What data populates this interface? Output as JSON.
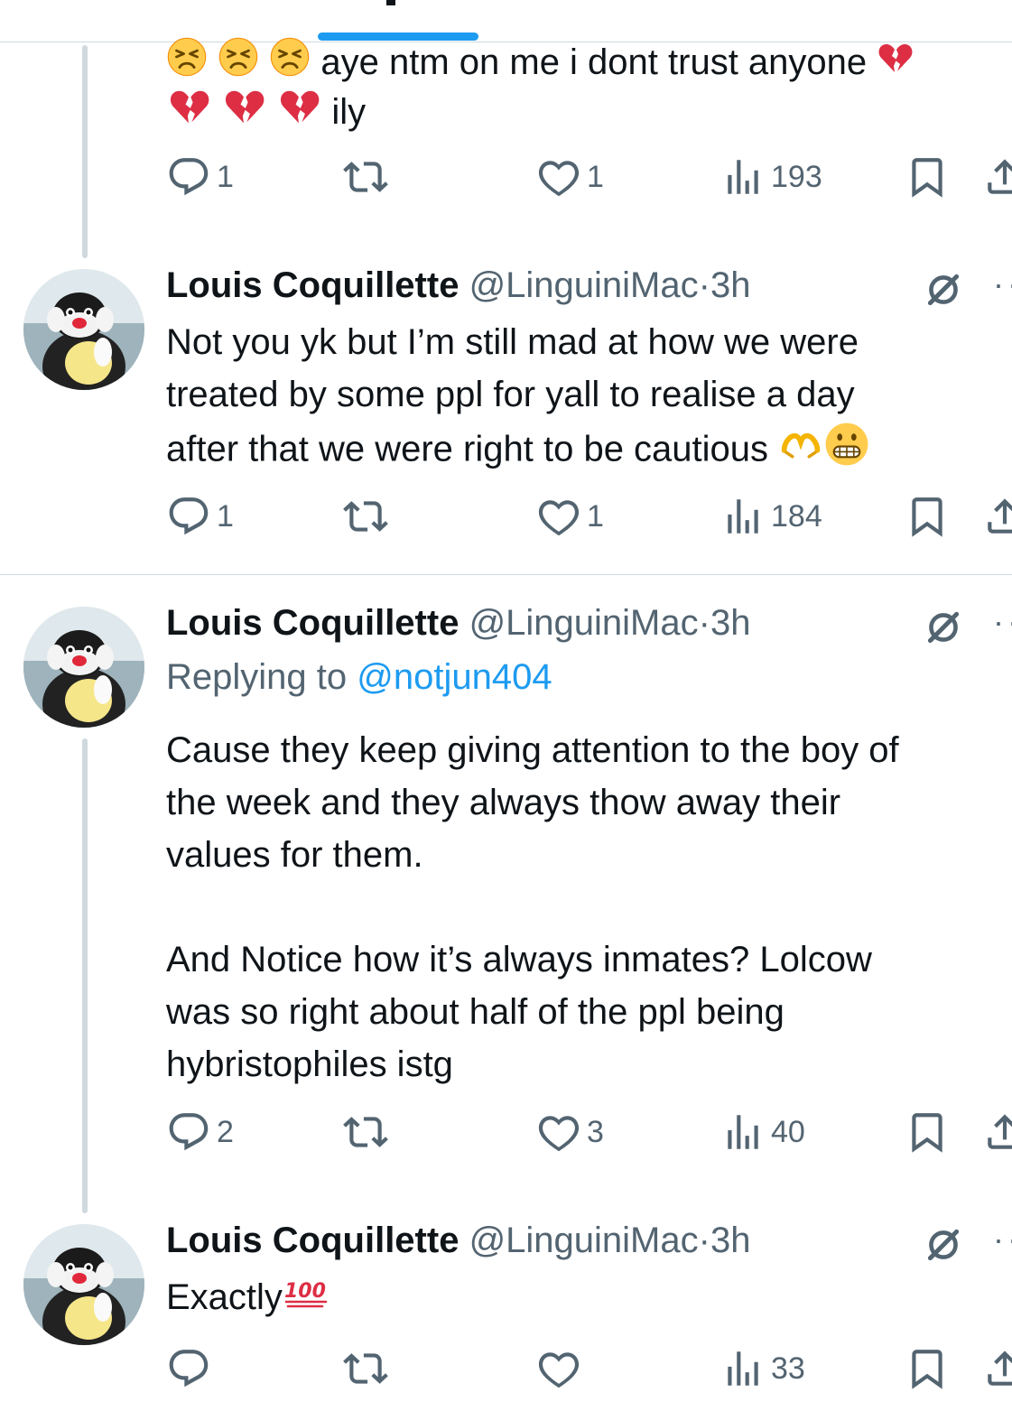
{
  "tweets": [
    {
      "text_lines": [
        "aye ntm on me i dont trust anyone",
        "ily"
      ],
      "emoji_row1": [
        "weary-face",
        "weary-face",
        "weary-face"
      ],
      "emoji_row2": [
        "broken-heart",
        "broken-heart",
        "broken-heart"
      ],
      "trailing_emoji": "broken-heart",
      "replies": "1",
      "reposts": "",
      "likes": "1",
      "views": "193"
    },
    {
      "name": "Louis Coquillette",
      "handle": "@LinguiniMac",
      "dot": "·",
      "time": "3h",
      "text_lines": [
        "Not you yk but I’m still mad at how we were",
        "treated by some ppl for yall to realise a day",
        "after that we were right to be cautious"
      ],
      "end_emojis": [
        "heart-hands",
        "grimacing-face"
      ],
      "replies": "1",
      "reposts": "",
      "likes": "1",
      "views": "184"
    },
    {
      "name": "Louis Coquillette",
      "handle": "@LinguiniMac",
      "dot": "·",
      "time": "3h",
      "replying_label": "Replying to",
      "replying_mention": "@notjun404",
      "text_lines": [
        "Cause they keep giving attention to the boy of",
        "the week and they always thow away their",
        "values for them.",
        "",
        "And Notice how it’s always inmates? Lolcow",
        "was so right about half of the ppl being",
        "hybristophiles istg"
      ],
      "replies": "2",
      "reposts": "",
      "likes": "3",
      "views": "40"
    },
    {
      "name": "Louis Coquillette",
      "handle": "@LinguiniMac",
      "dot": "·",
      "time": "3h",
      "text_lines": [
        "Exactly"
      ],
      "end_emojis": [
        "hundred-points"
      ],
      "replies": "",
      "reposts": "",
      "likes": "",
      "views": "33"
    }
  ],
  "more_glyph": "··",
  "colors": {
    "accent": "#1d9bf0",
    "muted": "#536471",
    "text": "#0f1419",
    "divider": "#cfd9de"
  }
}
